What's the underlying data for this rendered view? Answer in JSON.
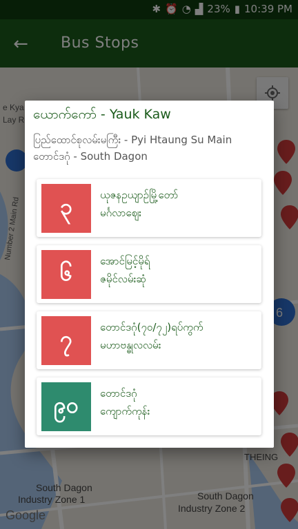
{
  "status_bar": {
    "battery": "23%",
    "time": "10:39 PM"
  },
  "app_bar": {
    "title": "Bus Stops",
    "back_icon": "arrow-left-icon"
  },
  "map": {
    "labels": {
      "street": "Number 2 Main Rd",
      "kyauk": "e Kya",
      "lay": "Lay Ro",
      "theing": "THEING",
      "zone1": [
        "South Dagon",
        "Industry Zone 1"
      ],
      "zone2": [
        "South Dagon",
        "Industry Zone 2"
      ],
      "brand": "Google",
      "right_badge": "6"
    }
  },
  "dialog": {
    "title": "ယောက်ကော် - Yauk Kaw",
    "subtitle_line1": "ပြည်ထောင်စုလမ်းမကြီး - Pyi Htaung Su Main",
    "subtitle_line2": "တောင်ဒဂုံ - South Dagon",
    "routes": [
      {
        "number": "၃",
        "color": "#e05252",
        "line1": "ယုဇနဥယျာဉ်မြို့တော်",
        "line2": "မင်္ဂလာဈေး"
      },
      {
        "number": "၆",
        "color": "#e05252",
        "line1": "အောင်မြင့်မိုရ်",
        "line2": "ဇမိုင်လမ်းဆုံ"
      },
      {
        "number": "၇",
        "color": "#e05252",
        "line1": "တောင်ဒဂုံ(၇၀/၇၂)ရပ်ကွက်",
        "line2": "မဟာဗန္ဓုလလမ်း"
      },
      {
        "number": "၉၀",
        "color": "#2e8b6e",
        "line1": "တောင်ဒဂုံ",
        "line2": "ကျောက်ကုန်း"
      }
    ]
  }
}
